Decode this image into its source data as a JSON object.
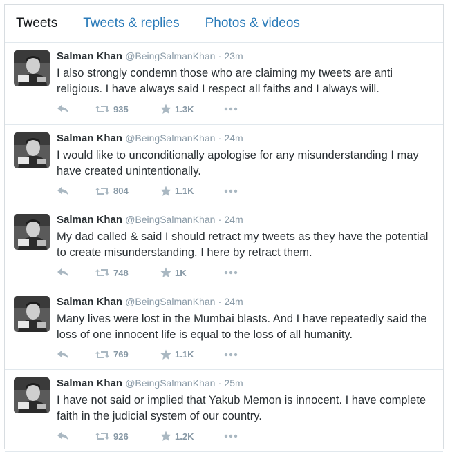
{
  "tabs": [
    {
      "label": "Tweets"
    },
    {
      "label": "Tweets & replies"
    },
    {
      "label": "Photos & videos"
    }
  ],
  "tweets": [
    {
      "name": "Salman Khan",
      "handle": "@BeingSalmanKhan",
      "time": "23m",
      "text": "I also strongly condemn those who are claiming my tweets are anti religious. I have always said I respect all faiths and I always will.",
      "retweets": "935",
      "favorites": "1.3K"
    },
    {
      "name": "Salman Khan",
      "handle": "@BeingSalmanKhan",
      "time": "24m",
      "text": "I would like to unconditionally apologise for any misunderstanding I may have created unintentionally.",
      "retweets": "804",
      "favorites": "1.1K"
    },
    {
      "name": "Salman Khan",
      "handle": "@BeingSalmanKhan",
      "time": "24m",
      "text": "My dad called & said I should retract my tweets as they have the potential to create misunderstanding. I here by retract them.",
      "retweets": "748",
      "favorites": "1K"
    },
    {
      "name": "Salman Khan",
      "handle": "@BeingSalmanKhan",
      "time": "24m",
      "text": "Many lives were lost in the Mumbai blasts. And I have repeatedly said the loss of one innocent life is equal to the loss of all humanity.",
      "retweets": "769",
      "favorites": "1.1K"
    },
    {
      "name": "Salman Khan",
      "handle": "@BeingSalmanKhan",
      "time": "25m",
      "text": "I have not said or implied that Yakub Memon is innocent. I have complete faith in the judicial system of our country.",
      "retweets": "926",
      "favorites": "1.2K"
    }
  ],
  "icons": {
    "reply": "reply-icon",
    "retweet": "retweet-icon",
    "favorite": "star-icon",
    "more": "more-dots-icon"
  },
  "colors": {
    "link": "#2b7bb9",
    "muted": "#8899a6",
    "icon": "#aab8c2"
  }
}
